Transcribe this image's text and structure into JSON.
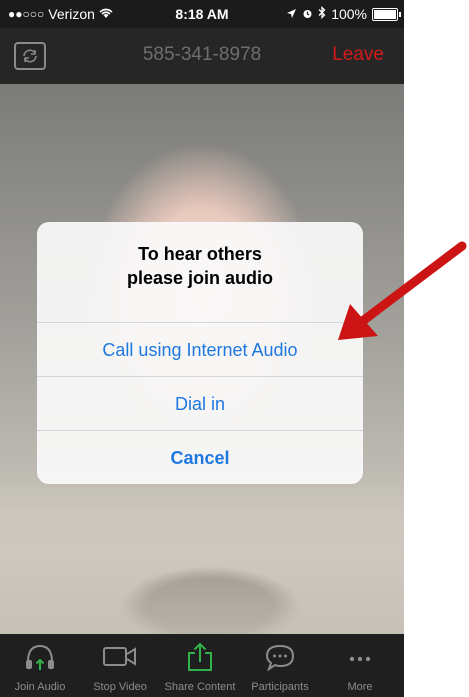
{
  "status_bar": {
    "signal": "●●○○○",
    "carrier": "Verizon",
    "wifi_icon": "wifi-icon",
    "time": "8:18 AM",
    "location_icon": "location-arrow-icon",
    "alarm_icon": "alarm-icon",
    "bluetooth_icon": "bluetooth-icon",
    "battery": "100%"
  },
  "header": {
    "phone_number": "585-341-8978",
    "leave_label": "Leave"
  },
  "dialog": {
    "title_line1": "To hear others",
    "title_line2": "please join audio",
    "buttons": {
      "internet_audio": "Call using Internet Audio",
      "dial_in": "Dial in",
      "cancel": "Cancel"
    }
  },
  "toolbar": {
    "items": [
      {
        "label": "Join Audio",
        "icon": "headphones-icon"
      },
      {
        "label": "Stop Video",
        "icon": "video-camera-icon"
      },
      {
        "label": "Share Content",
        "icon": "share-icon"
      },
      {
        "label": "Participants",
        "icon": "chat-bubble-icon"
      },
      {
        "label": "More",
        "icon": "more-dots-icon"
      }
    ]
  },
  "colors": {
    "accent_blue": "#1e78e0",
    "leave_red": "#d21a1a",
    "share_green": "#2fb34a",
    "arrow_red": "#cc1414"
  }
}
